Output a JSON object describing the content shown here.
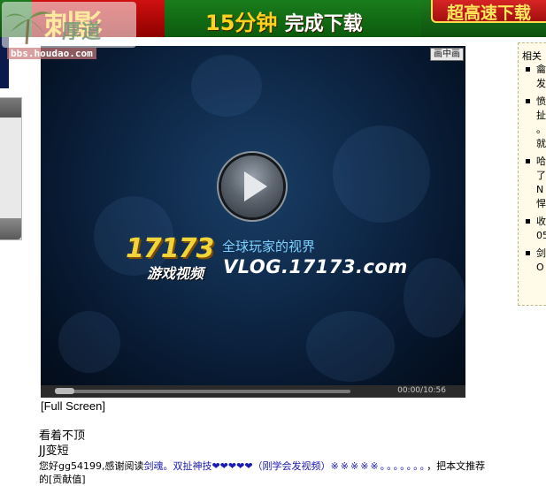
{
  "banner": {
    "art_text": "刺影",
    "promo_number": "15分钟",
    "promo_action": "完成下载",
    "right_tag": "超高速下载"
  },
  "watermark": {
    "url": "bbs.houdao.com"
  },
  "player": {
    "pip_label": "画中画",
    "logo_number": "17173",
    "logo_game": "游戏视频",
    "slogan": "全球玩家的视界",
    "site": "VLOG.17173.com",
    "time": "00:00/10:56",
    "progress_fraction": 0,
    "fullscreen_label": "[Full Screen]"
  },
  "related": {
    "title": "相关",
    "items": [
      [
        "龠",
        "发"
      ],
      [
        "愤",
        "扯",
        "。",
        "就"
      ],
      [
        "哈",
        "了",
        "N",
        "悍"
      ],
      [
        "收",
        "05"
      ],
      [
        "剑",
        "O"
      ]
    ]
  },
  "post": {
    "line1": "看着不顶",
    "line2": "JJ变短",
    "thanks_prefix": "您好gg54199,感谢阅读",
    "article_link": "剑魂。双扯神技❤❤❤❤❤（刚学会发视频）",
    "stars": "※※※※※",
    "dots": "。。。。。。。",
    "thanks_suffix": "，把本文推荐",
    "line4": "的[贡献值]"
  }
}
